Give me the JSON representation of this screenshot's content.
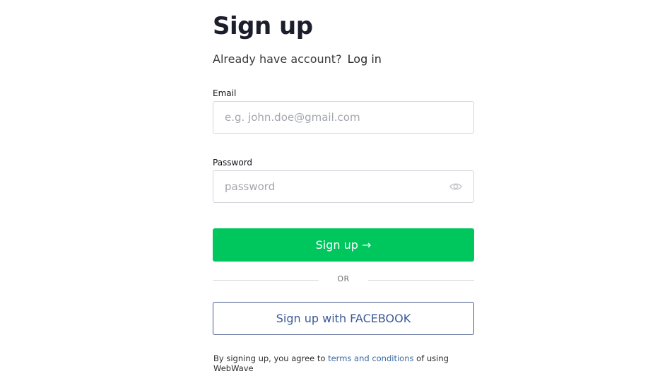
{
  "header": {
    "title": "Sign up",
    "login_prompt": "Already have account?",
    "login_link": "Log in"
  },
  "email": {
    "label": "Email",
    "value": "",
    "placeholder": "e.g. john.doe@gmail.com"
  },
  "password": {
    "label": "Password",
    "value": "",
    "placeholder": "password",
    "toggle_icon": "eye-icon"
  },
  "actions": {
    "signup_label": "Sign up →",
    "divider_text": "OR",
    "facebook_label": "Sign up with FACEBOOK"
  },
  "terms": {
    "prefix": "By signing up, you agree to ",
    "link": "terms and conditions",
    "suffix": " of using WebWave"
  },
  "colors": {
    "primary": "#00c65e",
    "facebook": "#3b5998",
    "link": "#3b6aa0"
  }
}
